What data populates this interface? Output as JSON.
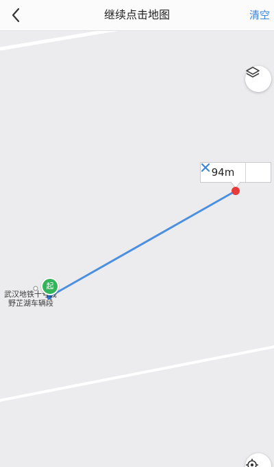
{
  "header": {
    "title": "继续点击地图",
    "clear_label": "清空"
  },
  "measurement": {
    "distance_label": "94m"
  },
  "markers": {
    "start_label": "起"
  },
  "poi": {
    "line1": "武汉地铁十号线",
    "line2": "野芷湖车辆段"
  },
  "icons": {
    "back": "chevron-left-icon",
    "layers": "layers-icon",
    "close": "close-icon",
    "locate": "locate-icon"
  },
  "colors": {
    "accent": "#3a86d8",
    "route": "#4a8fe0",
    "start": "#33b35a",
    "end": "#e53b3b"
  }
}
